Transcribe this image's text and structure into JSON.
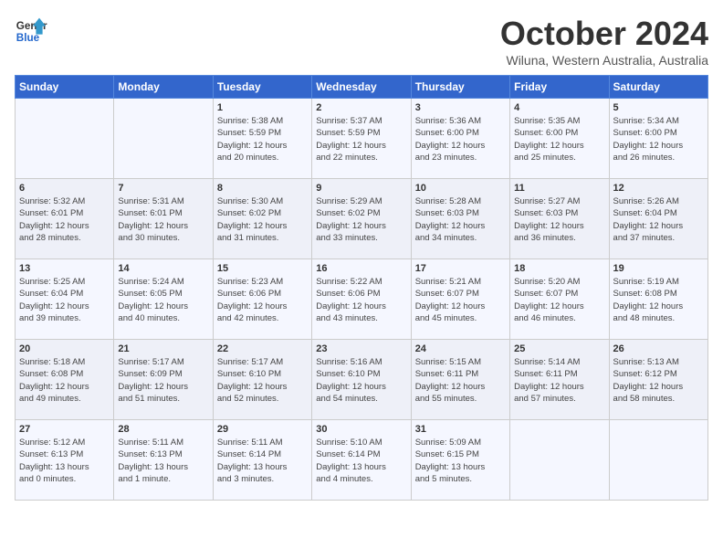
{
  "header": {
    "logo_line1": "General",
    "logo_line2": "Blue",
    "month": "October 2024",
    "location": "Wiluna, Western Australia, Australia"
  },
  "days_of_week": [
    "Sunday",
    "Monday",
    "Tuesday",
    "Wednesday",
    "Thursday",
    "Friday",
    "Saturday"
  ],
  "weeks": [
    [
      {
        "day": "",
        "info": ""
      },
      {
        "day": "",
        "info": ""
      },
      {
        "day": "1",
        "info": "Sunrise: 5:38 AM\nSunset: 5:59 PM\nDaylight: 12 hours\nand 20 minutes."
      },
      {
        "day": "2",
        "info": "Sunrise: 5:37 AM\nSunset: 5:59 PM\nDaylight: 12 hours\nand 22 minutes."
      },
      {
        "day": "3",
        "info": "Sunrise: 5:36 AM\nSunset: 6:00 PM\nDaylight: 12 hours\nand 23 minutes."
      },
      {
        "day": "4",
        "info": "Sunrise: 5:35 AM\nSunset: 6:00 PM\nDaylight: 12 hours\nand 25 minutes."
      },
      {
        "day": "5",
        "info": "Sunrise: 5:34 AM\nSunset: 6:00 PM\nDaylight: 12 hours\nand 26 minutes."
      }
    ],
    [
      {
        "day": "6",
        "info": "Sunrise: 5:32 AM\nSunset: 6:01 PM\nDaylight: 12 hours\nand 28 minutes."
      },
      {
        "day": "7",
        "info": "Sunrise: 5:31 AM\nSunset: 6:01 PM\nDaylight: 12 hours\nand 30 minutes."
      },
      {
        "day": "8",
        "info": "Sunrise: 5:30 AM\nSunset: 6:02 PM\nDaylight: 12 hours\nand 31 minutes."
      },
      {
        "day": "9",
        "info": "Sunrise: 5:29 AM\nSunset: 6:02 PM\nDaylight: 12 hours\nand 33 minutes."
      },
      {
        "day": "10",
        "info": "Sunrise: 5:28 AM\nSunset: 6:03 PM\nDaylight: 12 hours\nand 34 minutes."
      },
      {
        "day": "11",
        "info": "Sunrise: 5:27 AM\nSunset: 6:03 PM\nDaylight: 12 hours\nand 36 minutes."
      },
      {
        "day": "12",
        "info": "Sunrise: 5:26 AM\nSunset: 6:04 PM\nDaylight: 12 hours\nand 37 minutes."
      }
    ],
    [
      {
        "day": "13",
        "info": "Sunrise: 5:25 AM\nSunset: 6:04 PM\nDaylight: 12 hours\nand 39 minutes."
      },
      {
        "day": "14",
        "info": "Sunrise: 5:24 AM\nSunset: 6:05 PM\nDaylight: 12 hours\nand 40 minutes."
      },
      {
        "day": "15",
        "info": "Sunrise: 5:23 AM\nSunset: 6:06 PM\nDaylight: 12 hours\nand 42 minutes."
      },
      {
        "day": "16",
        "info": "Sunrise: 5:22 AM\nSunset: 6:06 PM\nDaylight: 12 hours\nand 43 minutes."
      },
      {
        "day": "17",
        "info": "Sunrise: 5:21 AM\nSunset: 6:07 PM\nDaylight: 12 hours\nand 45 minutes."
      },
      {
        "day": "18",
        "info": "Sunrise: 5:20 AM\nSunset: 6:07 PM\nDaylight: 12 hours\nand 46 minutes."
      },
      {
        "day": "19",
        "info": "Sunrise: 5:19 AM\nSunset: 6:08 PM\nDaylight: 12 hours\nand 48 minutes."
      }
    ],
    [
      {
        "day": "20",
        "info": "Sunrise: 5:18 AM\nSunset: 6:08 PM\nDaylight: 12 hours\nand 49 minutes."
      },
      {
        "day": "21",
        "info": "Sunrise: 5:17 AM\nSunset: 6:09 PM\nDaylight: 12 hours\nand 51 minutes."
      },
      {
        "day": "22",
        "info": "Sunrise: 5:17 AM\nSunset: 6:10 PM\nDaylight: 12 hours\nand 52 minutes."
      },
      {
        "day": "23",
        "info": "Sunrise: 5:16 AM\nSunset: 6:10 PM\nDaylight: 12 hours\nand 54 minutes."
      },
      {
        "day": "24",
        "info": "Sunrise: 5:15 AM\nSunset: 6:11 PM\nDaylight: 12 hours\nand 55 minutes."
      },
      {
        "day": "25",
        "info": "Sunrise: 5:14 AM\nSunset: 6:11 PM\nDaylight: 12 hours\nand 57 minutes."
      },
      {
        "day": "26",
        "info": "Sunrise: 5:13 AM\nSunset: 6:12 PM\nDaylight: 12 hours\nand 58 minutes."
      }
    ],
    [
      {
        "day": "27",
        "info": "Sunrise: 5:12 AM\nSunset: 6:13 PM\nDaylight: 13 hours\nand 0 minutes."
      },
      {
        "day": "28",
        "info": "Sunrise: 5:11 AM\nSunset: 6:13 PM\nDaylight: 13 hours\nand 1 minute."
      },
      {
        "day": "29",
        "info": "Sunrise: 5:11 AM\nSunset: 6:14 PM\nDaylight: 13 hours\nand 3 minutes."
      },
      {
        "day": "30",
        "info": "Sunrise: 5:10 AM\nSunset: 6:14 PM\nDaylight: 13 hours\nand 4 minutes."
      },
      {
        "day": "31",
        "info": "Sunrise: 5:09 AM\nSunset: 6:15 PM\nDaylight: 13 hours\nand 5 minutes."
      },
      {
        "day": "",
        "info": ""
      },
      {
        "day": "",
        "info": ""
      }
    ]
  ]
}
